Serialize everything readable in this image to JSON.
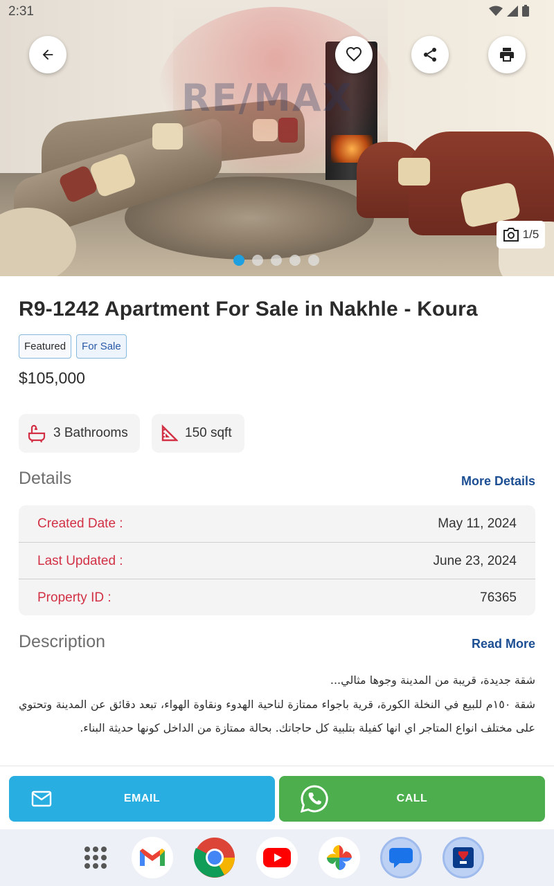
{
  "status_bar": {
    "time": "2:31"
  },
  "hero": {
    "photo_counter": "1/5",
    "active_photo": 1,
    "photo_total": 5,
    "watermark": "RE/MAX"
  },
  "listing": {
    "title": "R9-1242 Apartment For Sale in Nakhle - Koura",
    "tags": [
      "Featured",
      "For Sale"
    ],
    "price": "$105,000",
    "features": [
      {
        "icon": "bathtub-icon",
        "label": "3 Bathrooms"
      },
      {
        "icon": "set-square-icon",
        "label": "150 sqft"
      }
    ]
  },
  "details": {
    "heading": "Details",
    "link": "More Details",
    "rows": [
      {
        "label": "Created Date :",
        "value": "May 11, 2024"
      },
      {
        "label": "Last Updated :",
        "value": "June 23, 2024"
      },
      {
        "label": "Property ID :",
        "value": "76365"
      }
    ]
  },
  "description": {
    "heading": "Description",
    "link": "Read More",
    "line1": "شقة جديدة، قريبة من المدينة وجوها مثالي...",
    "line2": "شقة ١٥٠م للبيع في النخلة الكورة، قرية باجواء ممتازة لناحية الهدوء ونقاوة الهواء، تبعد دقائق عن المدينة وتحتوي على مختلف انواع المتاجر اي انها كفيلة بتلبية كل حاجاتك. بحالة ممتازة من الداخل كونها حديثة البناء."
  },
  "actions": {
    "email_label": "EMAIL",
    "call_label": "CALL"
  },
  "colors": {
    "email": "#29aee2",
    "call": "#4cae4c",
    "label_red": "#d23145",
    "link_blue": "#1c4e93",
    "dot_active": "#1ea0e0"
  },
  "dock": [
    "app-drawer-icon",
    "gmail-icon",
    "chrome-icon",
    "youtube-icon",
    "photos-icon",
    "messages-icon",
    "remax-app-icon"
  ]
}
